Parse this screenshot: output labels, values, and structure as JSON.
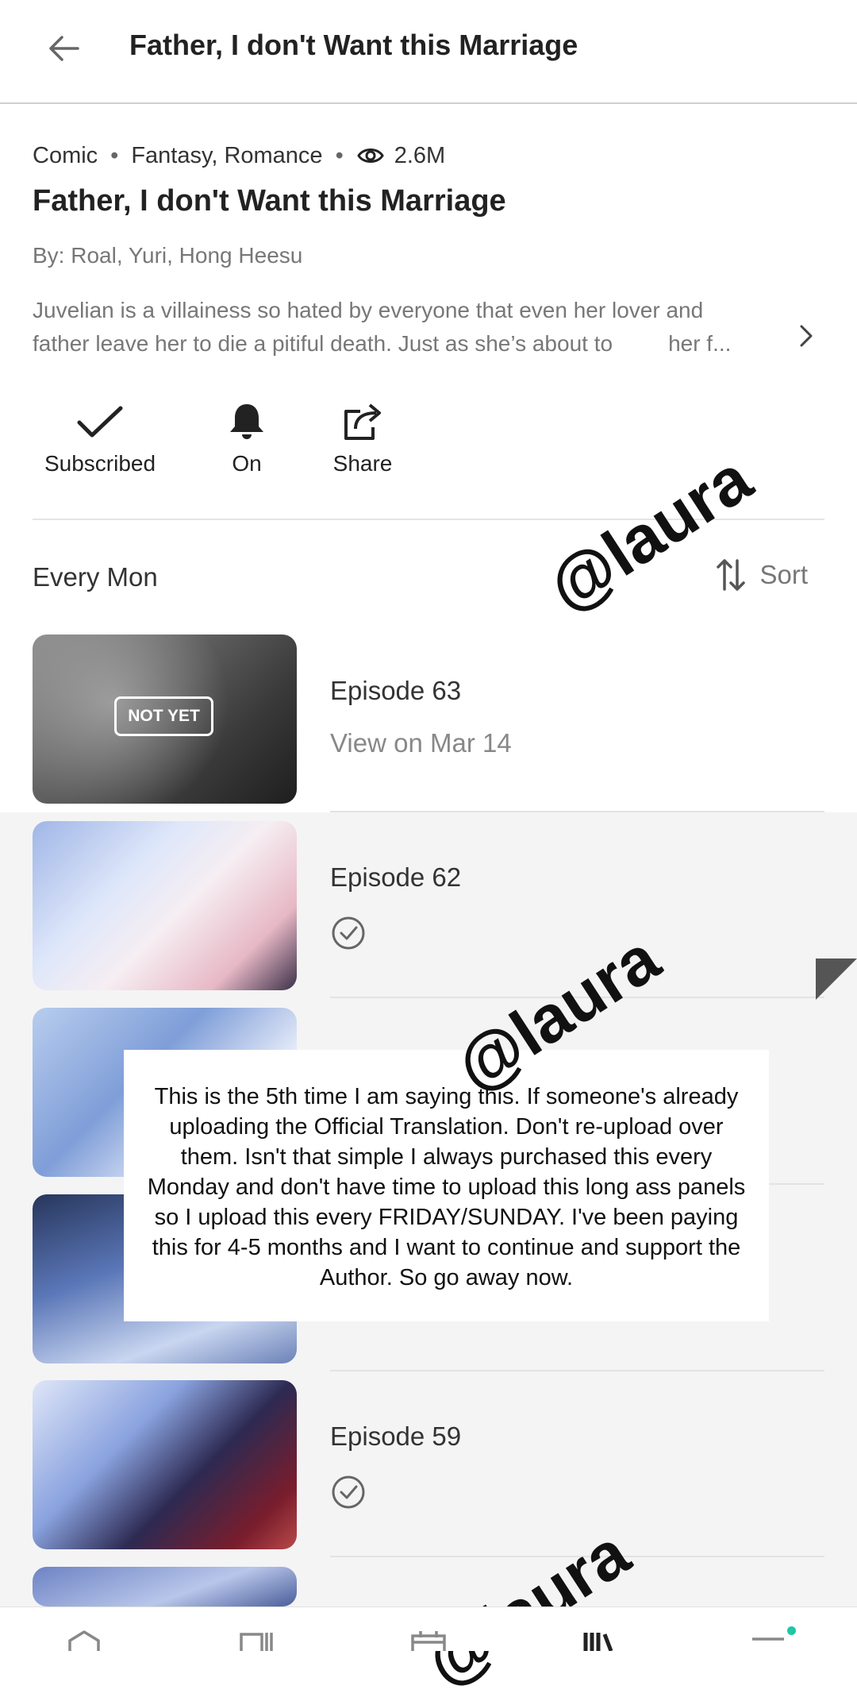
{
  "header": {
    "title": "Father, I don't Want this Marriage"
  },
  "meta": {
    "type": "Comic",
    "genres": "Fantasy, Romance",
    "views": "2.6M"
  },
  "series": {
    "title": "Father, I don't Want this Marriage",
    "authors": "By: Roal, Yuri, Hong Heesu",
    "description_line1": "Juvelian is a villainess so hated by everyone that even her lover and",
    "description_line2": "father leave her to die a pitiful death. Just as she’s about to",
    "description_tail": "her f..."
  },
  "actions": {
    "subscribe_label": "Subscribed",
    "alerts_label": "On",
    "share_label": "Share"
  },
  "schedule": "Every Mon",
  "sort_label": "Sort",
  "episodes": [
    {
      "title": "Episode 63",
      "subtitle": "View on Mar 14",
      "badge": "NOT YET"
    },
    {
      "title": "Episode 62",
      "status": "read"
    },
    {
      "title": "",
      "status": "read"
    },
    {
      "title": "",
      "status": "read"
    },
    {
      "title": "Episode 59",
      "status": "read"
    }
  ],
  "notice": "This is the 5th time I am saying this. If someone's already uploading the Official Translation. Don't re-upload over them. Isn't that simple I always purchased this every Monday and don't have time to upload this long ass panels so I upload this every FRIDAY/SUNDAY. I've been paying this for 4-5 months and I want to continue and support the Author. So go away now.",
  "watermark": "@laura",
  "colors": {
    "accent_dot": "#1ec8a5",
    "episode_bg": "#f4f4f4"
  },
  "bottom_nav": {
    "icons": [
      "home-icon",
      "library-icon",
      "calendar-icon",
      "bookshelf-icon",
      "menu-icon"
    ]
  }
}
